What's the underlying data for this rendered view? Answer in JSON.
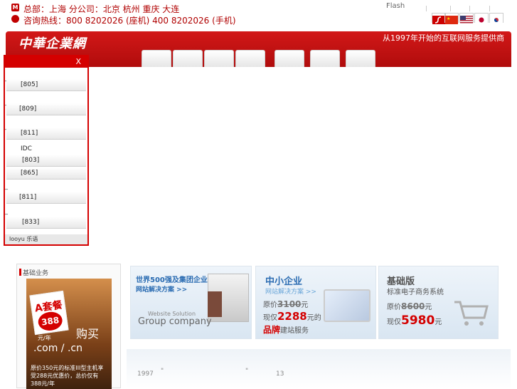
{
  "header": {
    "hq_icon": "M",
    "hq_line": "总部：上海   分公司：北京   杭州   重庆   大连",
    "hotline_line": "咨询热线：800 8202026 (座机)  400 8202026 (手机)",
    "flash_label": "Flash",
    "flags": [
      "flash-icon",
      "china-flag-icon",
      "usa-flag-icon",
      "japan-flag-icon",
      "korea-flag-icon"
    ]
  },
  "nav": {
    "logo": "中華企業網",
    "slogan": "从1997年开始的互联网服务提供商",
    "tabs": [
      "",
      "",
      "",
      "",
      "",
      "",
      ""
    ]
  },
  "popup": {
    "close": "X",
    "items": [
      {
        "code": "[805]"
      },
      {
        "code": "[809]"
      },
      {
        "code": "[811]"
      },
      {
        "code": "IDC"
      },
      {
        "code": "[803]"
      },
      {
        "code": "[865]"
      },
      {
        "code": "[811]"
      },
      {
        "code": "[833]"
      }
    ],
    "footer": "looyu 乐语"
  },
  "sidebar": {
    "title": "基础业务",
    "promo": {
      "tag_letter": "A套餐",
      "tag_price": "388",
      "tag_unit": "元/年",
      "buy": "购买",
      "domain": ".com / .cn",
      "desc": "原价350元的标准III型主机享受288元优惠价，总价仅有388元/年"
    }
  },
  "banners": {
    "b1": {
      "title": "世界500强及集团企业",
      "subtitle": "网站解决方案 >>",
      "en_small": "Website Solution",
      "en_big": "Group company"
    },
    "b2": {
      "title": "中小企业",
      "subtitle": "网站解决方案 >>",
      "orig_label": "原价",
      "orig_price": "3100",
      "orig_unit": "元",
      "now_label": "现仅",
      "now_price": "2288",
      "now_unit": "元的",
      "brand": "品牌",
      "brand_tail": "建站服务"
    },
    "b3": {
      "title": "基础版",
      "subtitle": "标准电子商务系统",
      "orig_label": "原价",
      "orig_price": "8600",
      "orig_unit": "元",
      "now_label": "现仅",
      "now_price": "5980",
      "now_unit": "元"
    }
  },
  "footer": {
    "year": "1997",
    "quote_open": "\"",
    "quote_close": "\"",
    "num": "13"
  }
}
